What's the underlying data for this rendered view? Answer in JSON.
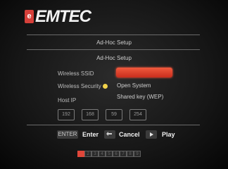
{
  "brand": {
    "logo_glyph": "e",
    "name": "EMTEC"
  },
  "header": {
    "title": "Ad-Hoc Setup"
  },
  "form": {
    "subtitle": "Ad-Hoc Setup",
    "ssid_label": "Wireless SSID",
    "ssid_value": "",
    "security_label": "Wireless Security",
    "security_options": [
      "Open System",
      "Shared key (WEP)"
    ],
    "security_selected": "Open System",
    "host_ip_label": "Host IP",
    "host_ip": [
      "192",
      "168",
      "59",
      "254"
    ]
  },
  "controls": {
    "enter_key": "ENTER",
    "enter_label": "Enter",
    "cancel_label": "Cancel",
    "play_label": "Play"
  },
  "pager": {
    "pages": [
      "",
      "2",
      "3",
      "4",
      "5",
      "6",
      "7",
      "8",
      "9"
    ],
    "active_index": 0
  },
  "colors": {
    "accent": "#e0473a",
    "selection_dot": "#f1d24a"
  }
}
